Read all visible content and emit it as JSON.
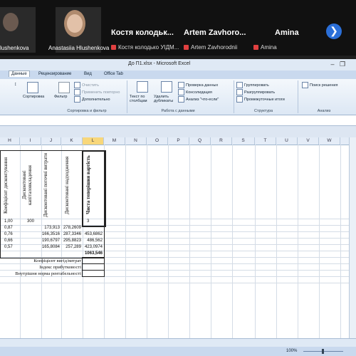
{
  "call": {
    "participants": [
      {
        "label": "lushenkova"
      },
      {
        "label": "Anastasiia Hlushenkova"
      },
      {
        "name": "Костя колодьк...",
        "sub": "Костя колодько УІДМ..."
      },
      {
        "name": "Artem Zavhoro...",
        "sub": "Artem Zavhorodnii"
      },
      {
        "name": "Amina",
        "sub": "Amina"
      }
    ],
    "next_icon": "chevron-right-icon"
  },
  "excel": {
    "title": "До П1.xlsx - Microsoft Excel",
    "tabs": [
      "Данные",
      "Рецензирование",
      "Вид",
      "Office Tab"
    ],
    "ribbon": {
      "sort": "Сортировка",
      "filter": "Фильтр",
      "clear": "Очистить",
      "reapply": "Применить повторно",
      "advanced": "Дополнительно",
      "text_to_columns": "Текст по столбцам",
      "remove_duplicates": "Удалить дубликаты",
      "validation": "Проверка данных",
      "consolidate": "Консолидация",
      "whatif": "Анализ \"что-если\"",
      "group": "Группировать",
      "ungroup": "Разгруппировать",
      "subtotal": "Промежуточные итоги",
      "solver": "Поиск решения",
      "group_sort": "Сортировка и фильтр",
      "group_data": "Работа с данными",
      "group_structure": "Структура",
      "group_analysis": "Анализ"
    },
    "columns": [
      "H",
      "I",
      "J",
      "K",
      "L",
      "M",
      "N",
      "O",
      "P",
      "Q",
      "R",
      "S",
      "T",
      "U",
      "V",
      "W"
    ],
    "headers": {
      "H": "Коефіцієнт дисконтування",
      "I": "Дисконтовані капіталовкладення",
      "J": "Дисконтовані поточні витрати",
      "K": "Дисконтовані надходження",
      "L": "Чиста теперішня вартість"
    },
    "rows": [
      {
        "H": "1,00",
        "I": "300",
        "J": "",
        "K": "",
        "L": "3"
      },
      {
        "H": "0,87",
        "I": "",
        "J": "173,913",
        "K": "278,2609",
        "L": ""
      },
      {
        "H": "0,76",
        "I": "",
        "J": "166,3516",
        "K": "287,3346",
        "L": "453,6862"
      },
      {
        "H": "0,66",
        "I": "",
        "J": "190,6797",
        "K": "295,8823",
        "L": "486,562"
      },
      {
        "H": "0,57",
        "I": "",
        "J": "165,8084",
        "K": "257,289",
        "L": "423,0974"
      },
      {
        "H": "",
        "I": "",
        "J": "",
        "K": "",
        "L": "1063,546"
      }
    ],
    "indicators": [
      "Коефіцієнт вигід/витрат",
      "Індекс прибутковості",
      "Внутрішня норма рентабельності"
    ],
    "zoom": "100%"
  }
}
